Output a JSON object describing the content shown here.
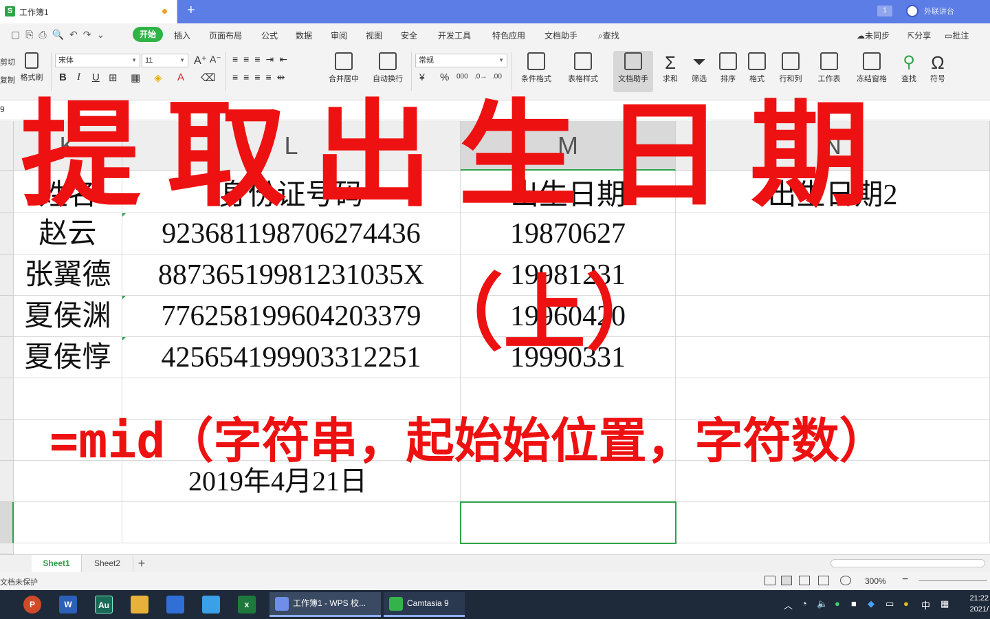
{
  "titlebar": {
    "tab_logo": "S",
    "tab_title": "工作簿1",
    "new_tab": "+",
    "badge": "1",
    "right_label": "外联讲台"
  },
  "menu": {
    "start": "开始",
    "items": [
      "插入",
      "页面布局",
      "公式",
      "数据",
      "审阅",
      "视图",
      "安全",
      "开发工具",
      "特色应用",
      "文档助手"
    ],
    "search": "查找",
    "sync": "未同步",
    "share": "分享",
    "comment": "批注"
  },
  "ribbon": {
    "cut": "剪切",
    "copy": "复制",
    "format_painter": "格式刷",
    "font_name": "宋体",
    "font_size": "11",
    "bold": "B",
    "italic": "I",
    "underline": "U",
    "merge_center": "合并居中",
    "wrap_text": "自动换行",
    "number_format": "常规",
    "percent": "%",
    "thousands": "000",
    "conditional_format": "条件格式",
    "table_style": "表格样式",
    "doc_assistant": "文档助手",
    "sum": "求和",
    "filter": "筛选",
    "sort": "排序",
    "format": "格式",
    "row_col": "行和列",
    "worksheet": "工作表",
    "freeze": "冻结窗格",
    "find": "查找",
    "symbol": "符号"
  },
  "formula_bar": {
    "name_box": "9"
  },
  "grid": {
    "col_headers": [
      "K",
      "L",
      "M",
      "N"
    ],
    "rows": [
      [
        "姓名",
        "身份证号码",
        "出生日期",
        "出生日期2"
      ],
      [
        "赵云",
        "923681198706274436",
        "19870627",
        ""
      ],
      [
        "张翼德",
        "88736519981231035X",
        "19981231",
        ""
      ],
      [
        "夏侯渊",
        "776258199604203379",
        "19960420",
        ""
      ],
      [
        "夏侯惇",
        "425654199903312251",
        "19990331",
        ""
      ],
      [
        "",
        "",
        "",
        ""
      ],
      [
        "",
        "",
        "",
        ""
      ],
      [
        "",
        "2019年4月21日",
        "",
        ""
      ],
      [
        "",
        "",
        "",
        ""
      ]
    ]
  },
  "sheets": {
    "tabs": [
      "Sheet1",
      "Sheet2"
    ],
    "add": "+"
  },
  "status": {
    "protect": "文档未保护",
    "zoom": "300%"
  },
  "taskbar": {
    "apps": [
      {
        "name": "powerpoint",
        "label": "P",
        "color": "#d04a2a"
      },
      {
        "name": "word",
        "label": "W",
        "color": "#2b5fb8"
      },
      {
        "name": "audition",
        "label": "Au",
        "color": "#1a6a58"
      },
      {
        "name": "explorer",
        "label": "",
        "color": "#e8b23a"
      },
      {
        "name": "app5",
        "label": "",
        "color": "#2f6fd6"
      },
      {
        "name": "app6",
        "label": "",
        "color": "#3aa0e8"
      },
      {
        "name": "excel",
        "label": "x",
        "color": "#1e7a3c"
      }
    ],
    "windows": [
      {
        "label": "工作簿1 - WPS 校...",
        "color": "#6f8ee8"
      },
      {
        "label": "Camtasia 9",
        "color": "#34b34a"
      }
    ],
    "ime": "中",
    "time": "21:22",
    "date": "2021/"
  },
  "overlay": {
    "title": "提取出生日期",
    "subtitle": "（上）",
    "formula": "=mid（字符串，起始始位置，字符数）"
  }
}
